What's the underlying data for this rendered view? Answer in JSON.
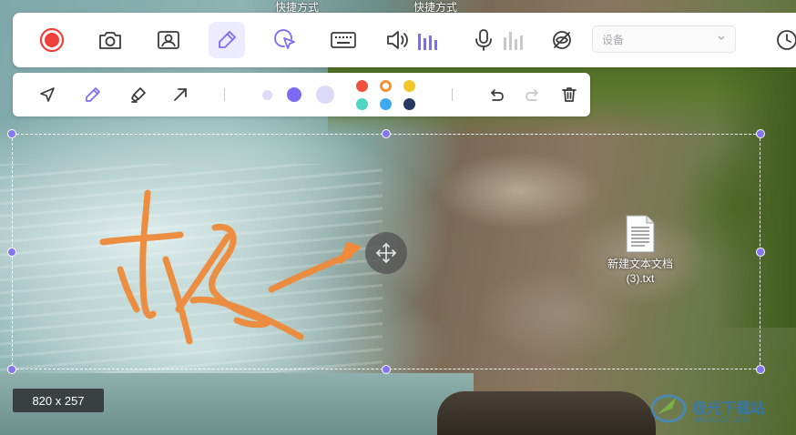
{
  "desktop": {
    "shortcut_labels": [
      "快捷方式",
      "快捷方式"
    ],
    "file": {
      "name_line1": "新建文本文档",
      "name_line2": "(3).txt"
    },
    "watermark": {
      "text": "极光下载站",
      "sub": "www.xz7.com"
    }
  },
  "main_toolbar": {
    "buttons": [
      {
        "name": "record-button",
        "icon": "record-icon"
      },
      {
        "name": "screenshot-button",
        "icon": "camera-icon"
      },
      {
        "name": "webcam-button",
        "icon": "webcam-icon"
      },
      {
        "name": "draw-button",
        "icon": "pen-icon",
        "active": true
      },
      {
        "name": "cursor-effect-button",
        "icon": "cursor-click-icon"
      },
      {
        "name": "keystroke-button",
        "icon": "keyboard-icon"
      },
      {
        "name": "system-audio-button",
        "icon": "speaker-icon"
      },
      {
        "name": "microphone-button",
        "icon": "microphone-icon"
      },
      {
        "name": "hide-toolbar-button",
        "icon": "eye-off-icon"
      },
      {
        "name": "timer-button",
        "icon": "clock-icon"
      }
    ],
    "device_select": {
      "placeholder": "设备"
    }
  },
  "draw_toolbar": {
    "tools": [
      "arrow-cursor-icon",
      "pencil-icon",
      "marker-icon",
      "arrow-line-icon"
    ],
    "active_tool": "pencil-icon",
    "sizes": [
      "small",
      "medium",
      "large"
    ],
    "active_size": "medium",
    "colors": [
      "#f0513f",
      "#f5912c",
      "#f5c62a",
      "#4fd6c0",
      "#3fa9f0",
      "#283a63"
    ],
    "active_color": "#f5912c",
    "actions": [
      "undo-icon",
      "redo-icon",
      "trash-icon"
    ]
  },
  "selection": {
    "dimensions": "820 x 257"
  },
  "colors": {
    "accent": "#7b6cf3",
    "record": "#f0403c",
    "annotation": "#ee8a3a"
  }
}
